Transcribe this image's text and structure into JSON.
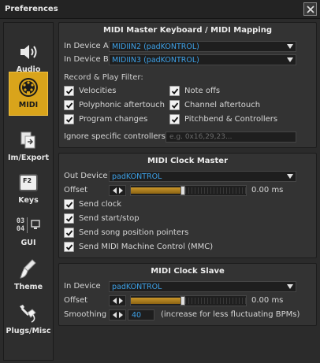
{
  "window": {
    "title": "Preferences"
  },
  "sidebar": {
    "items": [
      {
        "label": "Audio",
        "icon": "speaker-icon",
        "active": false
      },
      {
        "label": "MIDI",
        "icon": "midi-connector-icon",
        "active": true
      },
      {
        "label": "Im/Export",
        "icon": "import-export-icon",
        "active": false
      },
      {
        "label": "Keys",
        "icon": "keyboard-key-icon",
        "active": false
      },
      {
        "label": "GUI",
        "icon": "gui-display-icon",
        "active": false
      },
      {
        "label": "Theme",
        "icon": "paint-brush-icon",
        "active": false
      },
      {
        "label": "Plugs/Misc",
        "icon": "plug-icon",
        "active": false
      }
    ],
    "gui_icon_digits": [
      "03",
      "04"
    ],
    "keys_icon_text": "F2"
  },
  "mapping": {
    "title": "MIDI Master Keyboard / MIDI Mapping",
    "device_a_label": "In Device A",
    "device_a_value": "MIDIIN2 (padKONTROL)",
    "device_b_label": "In Device B",
    "device_b_value": "MIDIIN3 (padKONTROL)",
    "filter_label": "Record & Play Filter:",
    "filters": [
      {
        "label": "Velocities",
        "checked": true
      },
      {
        "label": "Note offs",
        "checked": true
      },
      {
        "label": "Polyphonic aftertouch",
        "checked": true
      },
      {
        "label": "Channel aftertouch",
        "checked": true
      },
      {
        "label": "Program changes",
        "checked": true
      },
      {
        "label": "Pitchbend & Controllers",
        "checked": true
      }
    ],
    "ignore_label": "Ignore specific controllers",
    "ignore_placeholder": "e.g. 0x16,29,23..."
  },
  "clock_master": {
    "title": "MIDI Clock Master",
    "out_device_label": "Out Device",
    "out_device_value": "padKONTROL",
    "offset_label": "Offset",
    "offset_value": "0.00 ms",
    "offset_fill": 0.45,
    "options": [
      {
        "label": "Send clock",
        "checked": true
      },
      {
        "label": "Send start/stop",
        "checked": true
      },
      {
        "label": "Send song position pointers",
        "checked": true
      },
      {
        "label": "Send MIDI Machine Control (MMC)",
        "checked": true
      }
    ]
  },
  "clock_slave": {
    "title": "MIDI Clock Slave",
    "in_device_label": "In Device",
    "in_device_value": "padKONTROL",
    "offset_label": "Offset",
    "offset_value": "0.00 ms",
    "offset_fill": 0.45,
    "smoothing_label": "Smoothing",
    "smoothing_value": "40",
    "smoothing_hint": "(increase for less fluctuating BPMs)"
  },
  "colors": {
    "accent": "#d9a41b",
    "value_text": "#3da0e6",
    "background": "#2b2b2b"
  }
}
